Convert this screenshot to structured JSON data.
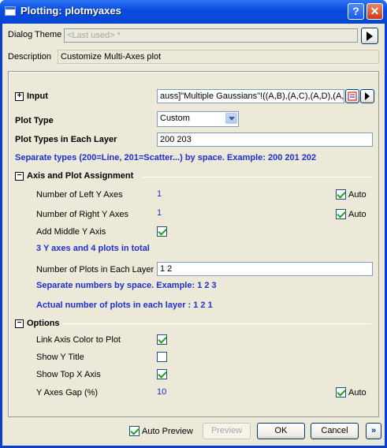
{
  "titlebar": {
    "title": "Plotting: plotmyaxes",
    "help_label": "?",
    "close_label": "✕"
  },
  "dialog_theme": {
    "label": "Dialog Theme",
    "value": "<Last used> *"
  },
  "description": {
    "label": "Description",
    "value": "Customize Multi-Axes plot"
  },
  "input": {
    "label": "Input",
    "value": "auss]\"Multiple Gaussians\"!((A,B),(A,C),(A,D),(A,E))"
  },
  "plot_type": {
    "label": "Plot Type",
    "value": "Custom"
  },
  "plot_types_layer": {
    "label": "Plot Types in Each Layer",
    "value": "200 203",
    "hint": "Separate types (200=Line, 201=Scatter...) by space. Example: 200 201 202"
  },
  "axis_section": {
    "title": "Axis and Plot Assignment",
    "left_y_label": "Number of Left Y Axes",
    "left_y_value": "1",
    "left_auto_label": "Auto",
    "right_y_label": "Number of Right Y Axes",
    "right_y_value": "1",
    "right_auto_label": "Auto",
    "middle_y_label": "Add Middle Y Axis",
    "summary": "3 Y axes and 4 plots in total",
    "plots_layer_label": "Number of Plots in Each Layer",
    "plots_layer_value": "1 2",
    "plots_hint": "Separate numbers by space. Example: 1 2 3",
    "actual_plots": "Actual number of plots in each layer : 1 2 1"
  },
  "options_section": {
    "title": "Options",
    "link_color_label": "Link Axis Color to Plot",
    "show_y_title_label": "Show Y Title",
    "show_top_x_label": "Show Top X Axis",
    "gap_label": "Y Axes Gap (%)",
    "gap_value": "10",
    "gap_auto_label": "Auto"
  },
  "footer": {
    "auto_preview_label": "Auto Preview",
    "preview_label": "Preview",
    "ok_label": "OK",
    "cancel_label": "Cancel",
    "more_label": "»"
  }
}
